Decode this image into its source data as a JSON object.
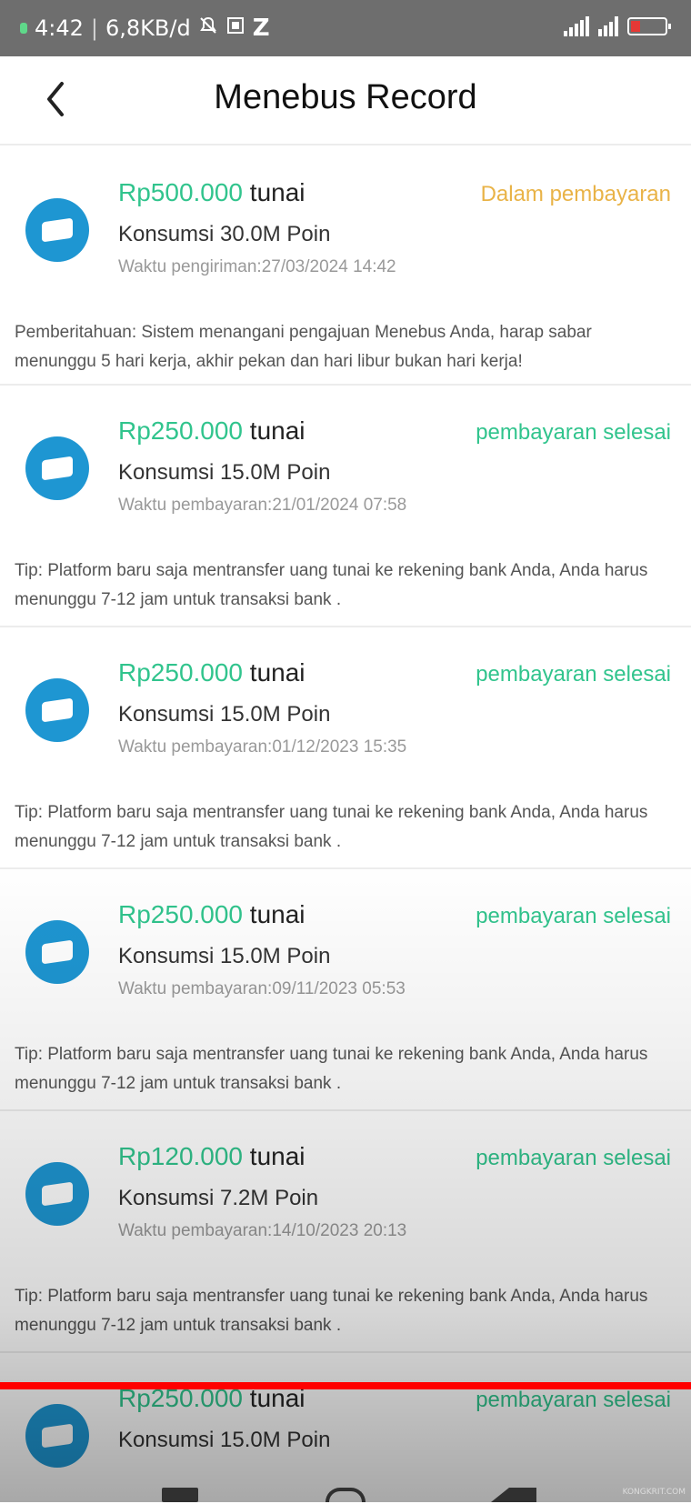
{
  "status_bar": {
    "time": "4:42",
    "speed": "6,8KB/d",
    "network_label": "Z",
    "battery_color": "#e53935"
  },
  "header": {
    "title": "Menebus Record",
    "back_icon": "chevron-left-icon"
  },
  "colors": {
    "accent_green": "#31c48d",
    "pending_orange": "#e9b347",
    "coin_blue": "#1e96d2"
  },
  "records": [
    {
      "amount": "Rp500.000",
      "currency": "tunai",
      "status": "Dalam pembayaran",
      "consume": "Konsumsi 30.0M Poin",
      "time": "Waktu pengiriman:27/03/2024 14:42",
      "note": "Pemberitahuan: Sistem menangani pengajuan Menebus Anda, harap sabar menunggu 5 hari kerja, akhir pekan dan hari libur bukan hari kerja!"
    },
    {
      "amount": "Rp250.000",
      "currency": "tunai",
      "status": "pembayaran selesai",
      "consume": "Konsumsi 15.0M Poin",
      "time": "Waktu pembayaran:21/01/2024 07:58",
      "note": "Tip: Platform baru saja mentransfer uang tunai ke rekening bank Anda, Anda harus menunggu 7-12 jam untuk transaksi bank ."
    },
    {
      "amount": "Rp250.000",
      "currency": "tunai",
      "status": "pembayaran selesai",
      "consume": "Konsumsi 15.0M Poin",
      "time": "Waktu pembayaran:01/12/2023 15:35",
      "note": "Tip: Platform baru saja mentransfer uang tunai ke rekening bank Anda, Anda harus menunggu 7-12 jam untuk transaksi bank ."
    },
    {
      "amount": "Rp250.000",
      "currency": "tunai",
      "status": "pembayaran selesai",
      "consume": "Konsumsi 15.0M Poin",
      "time": "Waktu pembayaran:09/11/2023 05:53",
      "note": "Tip: Platform baru saja mentransfer uang tunai ke rekening bank Anda, Anda harus menunggu 7-12 jam untuk transaksi bank ."
    },
    {
      "amount": "Rp120.000",
      "currency": "tunai",
      "status": "pembayaran selesai",
      "consume": "Konsumsi 7.2M Poin",
      "time": "Waktu pembayaran:14/10/2023 20:13",
      "note": "Tip: Platform baru saja mentransfer uang tunai ke rekening bank Anda, Anda harus menunggu 7-12 jam untuk transaksi bank ."
    },
    {
      "amount": "Rp250.000",
      "currency": "tunai",
      "status": "pembayaran selesai",
      "consume": "Konsumsi 15.0M Poin"
    }
  ],
  "watermark": "KONGKRIT.COM"
}
